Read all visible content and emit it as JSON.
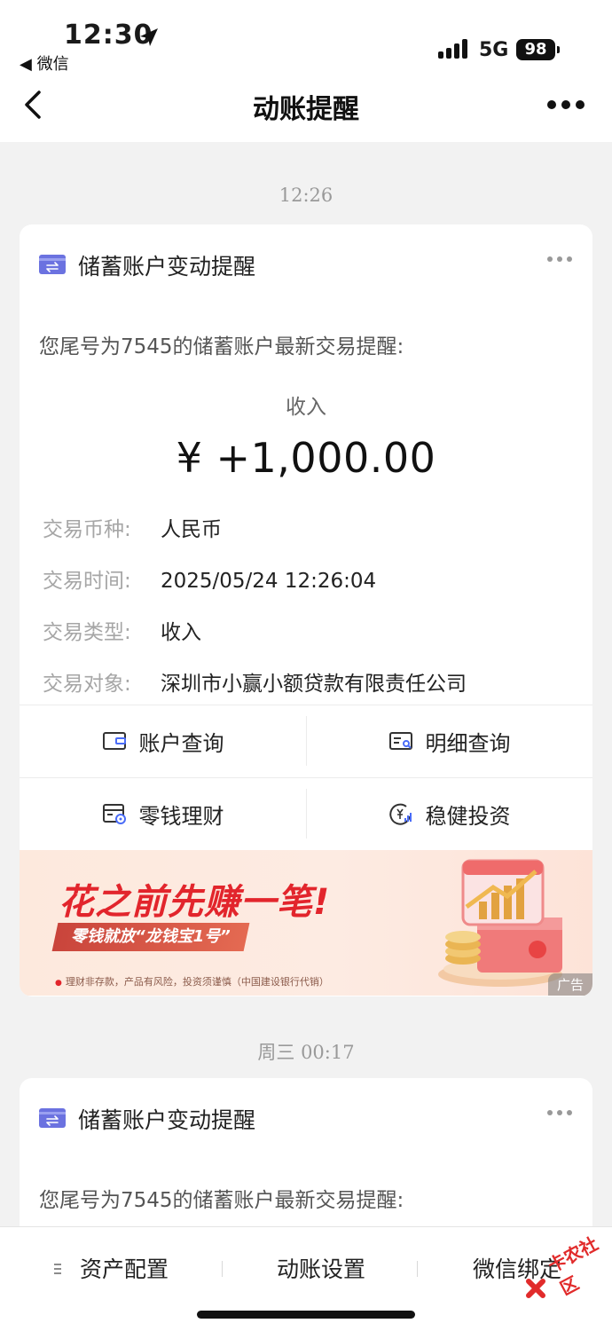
{
  "status_bar": {
    "time": "12:30",
    "back_app": "◀ 微信",
    "network": "5G",
    "battery": "98"
  },
  "nav": {
    "title": "动账提醒"
  },
  "messages": [
    {
      "timestamp": "12:26",
      "card_title": "储蓄账户变动提醒",
      "intro": "您尾号为7545的储蓄账户最新交易提醒:",
      "type_label": "收入",
      "amount": "¥ +1,000.00",
      "rows": [
        {
          "key": "交易币种:",
          "value": "人民币"
        },
        {
          "key": "交易时间:",
          "value": "2025/05/24 12:26:04"
        },
        {
          "key": "交易类型:",
          "value": "收入"
        },
        {
          "key": "交易对象:",
          "value": "深圳市小赢小额贷款有限责任公司"
        }
      ],
      "buttons": [
        {
          "label": "账户查询",
          "icon": "wallet-icon"
        },
        {
          "label": "明细查询",
          "icon": "detail-search-icon"
        },
        {
          "label": "零钱理财",
          "icon": "card-coin-icon"
        },
        {
          "label": "稳健投资",
          "icon": "yuan-chart-icon"
        }
      ],
      "ad": {
        "headline": "花之前先赚一笔!",
        "subline": "零钱就放“龙钱宝1号”",
        "note": "理财非存款，产品有风险，投资须谨慎（中国建设银行代销）",
        "tag": "广告"
      }
    },
    {
      "timestamp": "周三 00:17",
      "card_title": "储蓄账户变动提醒",
      "intro": "您尾号为7545的储蓄账户最新交易提醒:"
    }
  ],
  "tabbar": {
    "tabs": [
      "资产配置",
      "动账设置",
      "微信绑定"
    ]
  },
  "watermark": "卡农社区",
  "colors": {
    "accent_icon": "#6b72e0",
    "ad_red": "#e2252c",
    "timestamp": "#9a9a9a"
  }
}
